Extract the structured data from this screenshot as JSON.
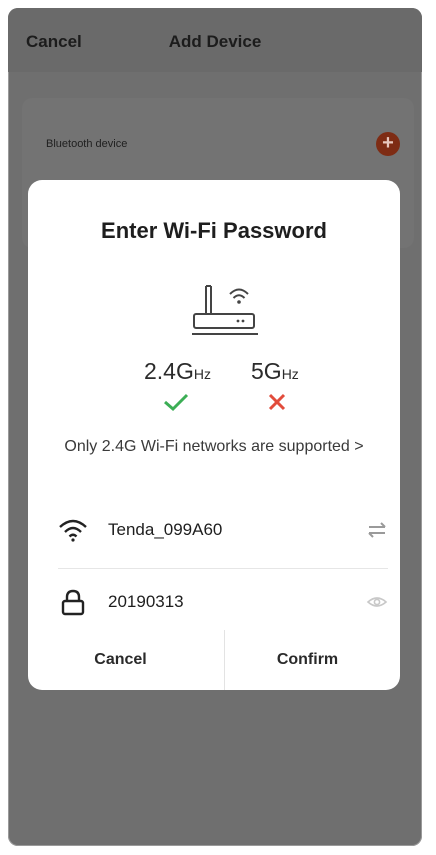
{
  "header": {
    "cancel_label": "Cancel",
    "title": "Add Device"
  },
  "bluetooth_card": {
    "label": "Bluetooth device",
    "add_icon": "plus-circle-icon",
    "accent_color": "#7e2c14"
  },
  "dialog": {
    "title": "Enter Wi-Fi Password",
    "router_icon": "router-wifi-icon",
    "bands": [
      {
        "label": "2.4G",
        "unit": "Hz",
        "supported": true,
        "status_icon": "check-icon",
        "status_color": "#3cae55"
      },
      {
        "label": "5G",
        "unit": "Hz",
        "supported": false,
        "status_icon": "cross-icon",
        "status_color": "#e24c3b"
      }
    ],
    "note": "Only 2.4G Wi-Fi networks are supported",
    "note_chevron": ">",
    "wifi": {
      "icon": "wifi-icon",
      "ssid": "Tenda_099A60",
      "switch_icon": "switch-network-icon"
    },
    "password": {
      "icon": "lock-icon",
      "value": "20190313",
      "visibility_icon": "eye-icon"
    },
    "buttons": {
      "cancel": "Cancel",
      "confirm": "Confirm"
    }
  }
}
